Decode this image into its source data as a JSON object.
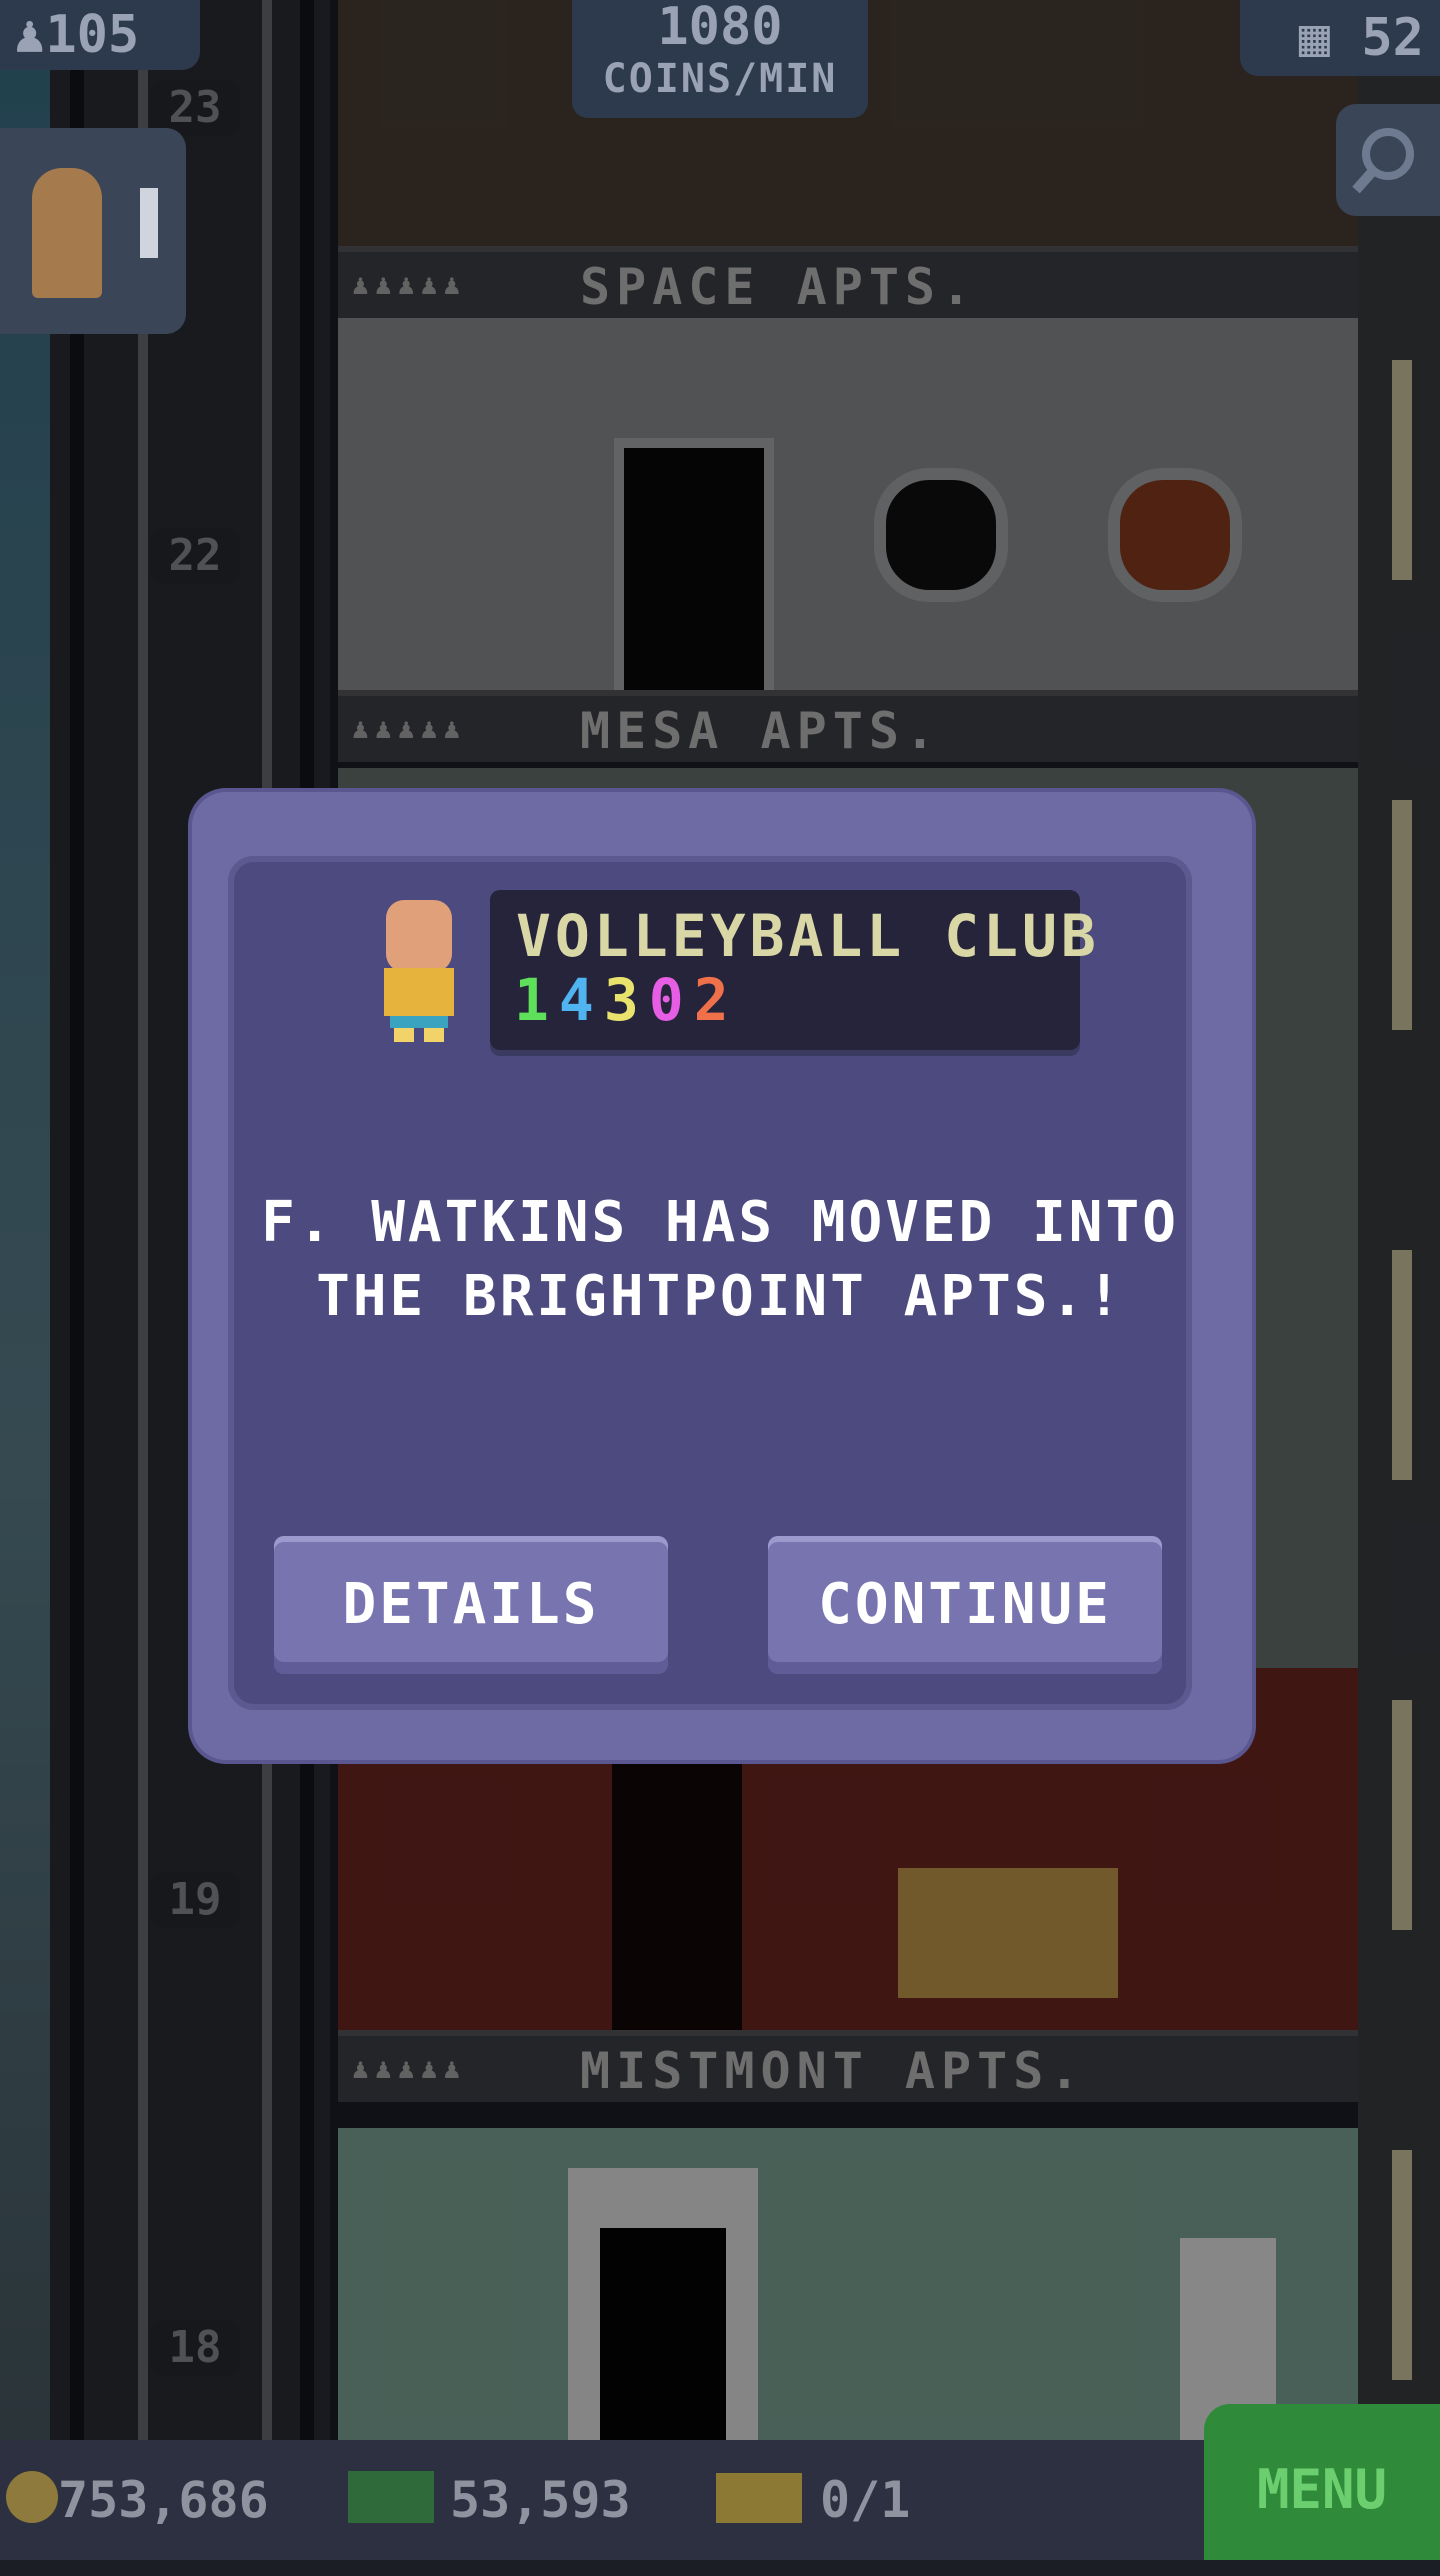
{
  "hud": {
    "population": "105",
    "coins_per_min_value": "1080",
    "coins_per_min_label": "COINS/MIN",
    "floors": "52"
  },
  "floors": [
    {
      "number": "23",
      "sign": "SPACE APTS."
    },
    {
      "number": "22",
      "sign": "MESA APTS."
    },
    {
      "number": "19",
      "sign": "MISTMONT APTS."
    },
    {
      "number": "18",
      "sign": ""
    }
  ],
  "dialog": {
    "club_name": "VOLLEYBALL CLUB",
    "club_code": [
      "1",
      "4",
      "3",
      "0",
      "2"
    ],
    "club_code_colors": [
      "#5ee05a",
      "#4fb4f0",
      "#e9e36d",
      "#e55ee3",
      "#f0704a"
    ],
    "message": "F. WATKINS HAS MOVED INTO THE BRIGHTPOINT APTS.!",
    "details_label": "DETAILS",
    "continue_label": "CONTINUE"
  },
  "bottom_bar": {
    "coins": "753,686",
    "bux": "53,593",
    "tickets": "0/1",
    "menu_label": "MENU"
  }
}
